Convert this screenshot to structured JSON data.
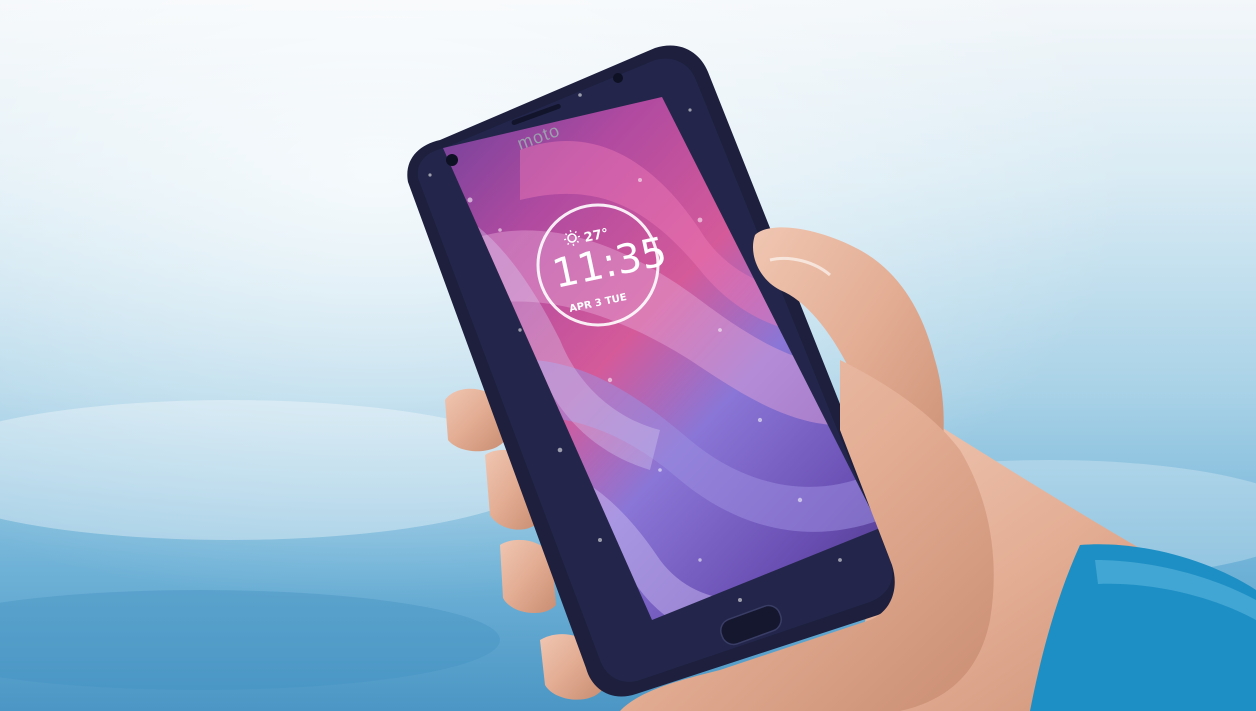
{
  "photo": {
    "brand_logo": "moto",
    "clock_widget": {
      "weather_icon": "sun-icon",
      "temperature": "27°",
      "time": "11:35",
      "date": "APR 3 TUE"
    },
    "colors": {
      "water_light": "#eef4f8",
      "water_mid": "#9ccbe3",
      "water_deep": "#4a97c6",
      "phone_body": "#1d1f3d",
      "screen_pink": "#c2468f",
      "screen_violet": "#7c6fd0",
      "screen_deep": "#3a2a6e",
      "skin": "#e6b39c",
      "wristband": "#1e8fc4"
    }
  }
}
